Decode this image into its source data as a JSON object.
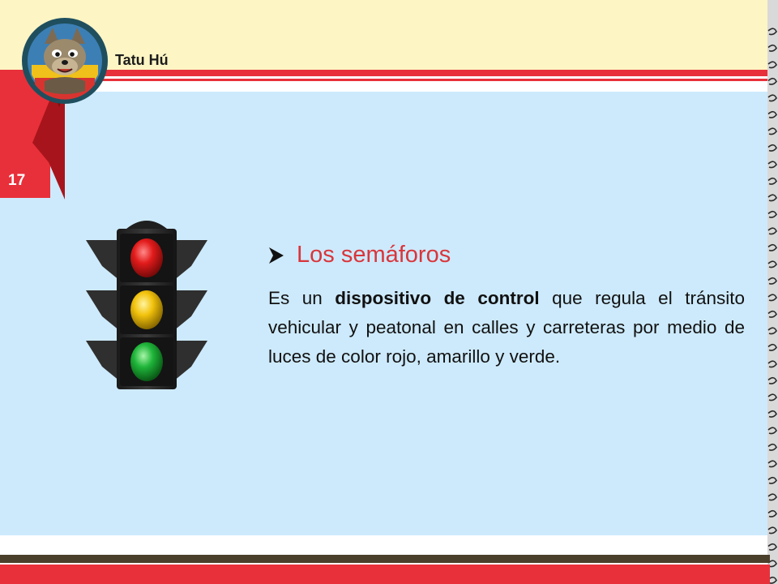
{
  "header": {
    "brand": "Tatu Hú",
    "logo_icon": "tatu-mascot-logo-icon"
  },
  "page": {
    "number": "17"
  },
  "content": {
    "bullet_icon": "arrowhead-bullet-icon",
    "heading": "Los semáforos",
    "text_before": "Es un ",
    "text_bold": "dispositivo de control",
    "text_after": " que regula el tránsito vehicular y peatonal en calles y carreteras por medio de luces de color rojo, amarillo y verde.",
    "illustration": "traffic-light-icon"
  },
  "colors": {
    "header_band": "#fdf5c4",
    "accent_red": "#e8303a",
    "content_bg": "#cdeafc",
    "footer_dark": "#4a3f2a",
    "light_red": "#e21b1b",
    "light_yellow": "#f2c20c",
    "light_green": "#1fb53a"
  }
}
